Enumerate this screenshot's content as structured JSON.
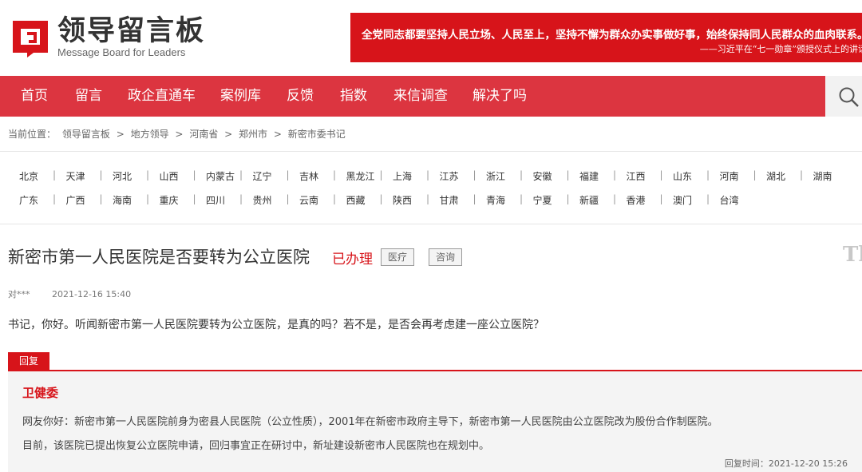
{
  "header": {
    "logo_title": "领导留言板",
    "logo_subtitle": "Message Board for Leaders",
    "banner_line1": "全党同志都要坚持人民立场、人民至上，坚持不懈为群众办实事做好事，始终保持同人民群众的血肉联系。",
    "banner_line2": "——习近平在“七一勋章”颁授仪式上的讲话",
    "brand_color": "#dc3540"
  },
  "nav": {
    "items": [
      "首页",
      "留言",
      "政企直通车",
      "案例库",
      "反馈",
      "指数",
      "来信调查",
      "解决了吗"
    ]
  },
  "breadcrumb": {
    "prefix": "当前位置：",
    "items": [
      "领导留言板",
      "地方领导",
      "河南省",
      "郑州市",
      "新密市委书记"
    ],
    "separator": ">"
  },
  "regions": {
    "row1": [
      "北京",
      "天津",
      "河北",
      "山西",
      "内蒙古",
      "辽宁",
      "吉林",
      "黑龙江",
      "上海",
      "江苏",
      "浙江",
      "安徽",
      "福建",
      "江西",
      "山东",
      "河南",
      "湖北",
      "湖南"
    ],
    "row2": [
      "广东",
      "广西",
      "海南",
      "重庆",
      "四川",
      "贵州",
      "云南",
      "西藏",
      "陕西",
      "甘肃",
      "青海",
      "宁夏",
      "新疆",
      "香港",
      "澳门",
      "台湾"
    ],
    "separator": "|"
  },
  "message": {
    "title": "新密市第一人民医院是否要转为公立医院",
    "status": "已办理",
    "tags": [
      "医疗",
      "咨询"
    ],
    "ghost_text": "Th",
    "author": "对***",
    "time": "2021-12-16 15:40",
    "content": "书记，你好。听闻新密市第一人民医院要转为公立医院，是真的吗？若不是，是否会再考虑建一座公立医院？"
  },
  "reply": {
    "label": "回复",
    "org": "卫健委",
    "paragraphs": [
      "网友你好：新密市第一人民医院前身为密县人民医院（公立性质），2001年在新密市政府主导下，新密市第一人民医院由公立医院改为股份合作制医院。",
      "目前，该医院已提出恢复公立医院申请，回归事宜正在研讨中，新址建设新密市人民医院也在规划中。"
    ],
    "time": "回复时间：2021-12-20 15:26"
  },
  "icons": {
    "logo": "message-board-logo-icon",
    "search": "search-icon"
  }
}
